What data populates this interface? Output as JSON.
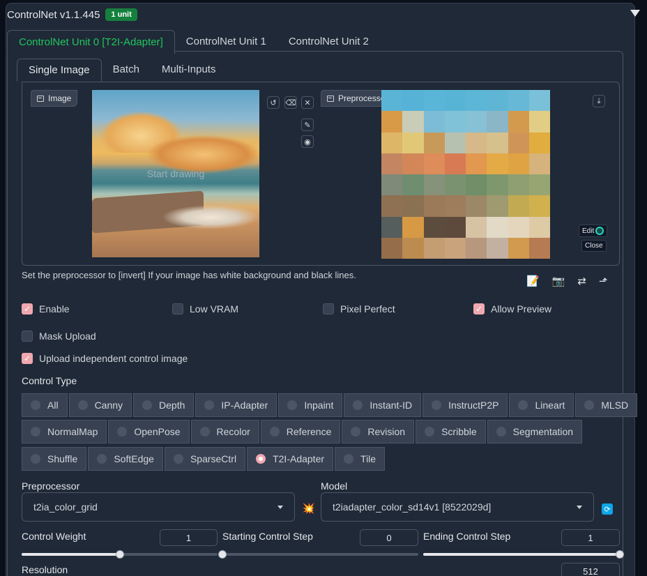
{
  "header": {
    "title": "ControlNet v1.1.445",
    "badge": "1 unit"
  },
  "unit_tabs": [
    "ControlNet Unit 0 [T2I-Adapter]",
    "ControlNet Unit 1",
    "ControlNet Unit 2"
  ],
  "input_tabs": [
    "Single Image",
    "Batch",
    "Multi-Inputs"
  ],
  "image_panel": {
    "label": "Image",
    "overlay_text": "Start drawing"
  },
  "preview_panel": {
    "label": "Preprocessor Preview",
    "edit_label": "Edit",
    "close_label": "Close"
  },
  "hint": "Set the preprocessor to [invert] If your image has white background and black lines.",
  "checkboxes": {
    "enable": {
      "label": "Enable",
      "checked": true
    },
    "low_vram": {
      "label": "Low VRAM",
      "checked": false
    },
    "pixel_perfect": {
      "label": "Pixel Perfect",
      "checked": false
    },
    "allow_preview": {
      "label": "Allow Preview",
      "checked": true
    },
    "mask_upload": {
      "label": "Mask Upload",
      "checked": false
    },
    "upload_independent": {
      "label": "Upload independent control image",
      "checked": true
    }
  },
  "control_type": {
    "label": "Control Type",
    "row1": [
      "All",
      "Canny",
      "Depth",
      "IP-Adapter",
      "Inpaint",
      "Instant-ID",
      "InstructP2P",
      "Lineart",
      "MLSD"
    ],
    "row2": [
      "NormalMap",
      "OpenPose",
      "Recolor",
      "Reference",
      "Revision",
      "Scribble",
      "Segmentation"
    ],
    "row3": [
      "Shuffle",
      "SoftEdge",
      "SparseCtrl",
      "T2I-Adapter",
      "Tile"
    ],
    "selected": "T2I-Adapter"
  },
  "preprocessor": {
    "label": "Preprocessor",
    "value": "t2ia_color_grid"
  },
  "model": {
    "label": "Model",
    "value": "t2iadapter_color_sd14v1 [8522029d]"
  },
  "sliders": {
    "control_weight": {
      "label": "Control Weight",
      "value": "1",
      "fraction": 0.5
    },
    "starting_step": {
      "label": "Starting Control Step",
      "value": "0",
      "fraction": 0.0
    },
    "ending_step": {
      "label": "Ending Control Step",
      "value": "1",
      "fraction": 1.0
    },
    "resolution": {
      "label": "Resolution",
      "value": "512"
    }
  },
  "colors": {
    "accent_green": "#22c55e",
    "badge_green": "#15803d",
    "checkbox_pink": "#f0a8b0",
    "grid": [
      "#5ab4d6",
      "#56b2d6",
      "#5ab6d8",
      "#58b4d5",
      "#5cb6d6",
      "#5fb6d4",
      "#66b8d6",
      "#7ac0d8",
      "#d99a48",
      "#c9cdb8",
      "#7dbcd6",
      "#80c2d8",
      "#86c1d6",
      "#8ab6c8",
      "#d39a4e",
      "#e2cd84",
      "#deb668",
      "#e0c878",
      "#c89a5a",
      "#b7c1b0",
      "#d6b889",
      "#d6c08c",
      "#cf9558",
      "#e0ad3e",
      "#c38562",
      "#d38758",
      "#dd8c5a",
      "#d87a53",
      "#e2984e",
      "#e3aa46",
      "#dfa344",
      "#d6b37c",
      "#808a78",
      "#6f8e6f",
      "#86927a",
      "#7b9271",
      "#708e68",
      "#7f976d",
      "#8f9f72",
      "#97a572",
      "#8e7152",
      "#8a7152",
      "#9a7a58",
      "#9e7d5d",
      "#9b8867",
      "#9f9a6f",
      "#c2aa52",
      "#d0b14e",
      "#555e5d",
      "#d79944",
      "#5b4c3e",
      "#5d4a3c",
      "#d6c3a4",
      "#e2dac7",
      "#e3d6bc",
      "#dfcaa6",
      "#956d4b",
      "#bc8b50",
      "#c49d73",
      "#c8a37c",
      "#b7977d",
      "#c2b0a1",
      "#d19a4f",
      "#b67b52"
    ]
  }
}
